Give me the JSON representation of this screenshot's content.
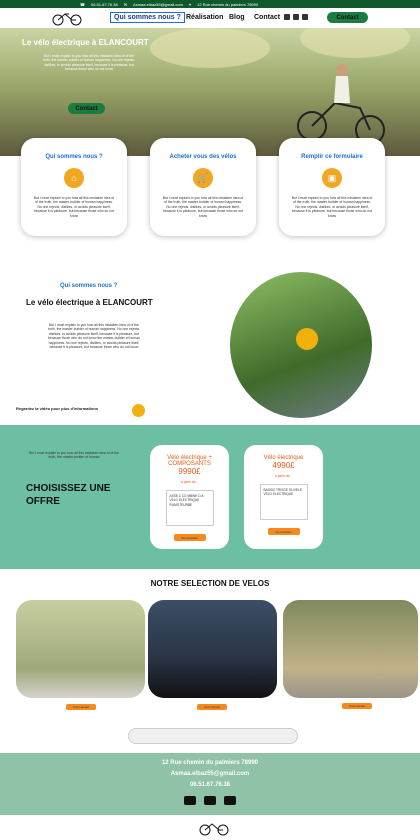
{
  "topbar": {
    "phone": "06.51.67.76.38",
    "email": "Asmaa.elbaz55@gmail.com",
    "address": "12 Rue chemin du palmiers 78990"
  },
  "nav": {
    "items": [
      "Qui sommes nous ?",
      "Réalisation",
      "Blog",
      "Contact"
    ],
    "cta": "Contact"
  },
  "hero": {
    "title": "Le vélo électrique  à ELANCOURT",
    "body": "But I must explain to you how all this mistaken idea of of the truth, the master-builder of human happiness. No one rejects, dislikes, or avoids pleasure itself, because it is pleasure, but because those who do not know",
    "button": "Contact"
  },
  "cards": [
    {
      "title": "Qui sommes nous ?",
      "icon": "home-icon",
      "body": "But I must explain to you how all this mistaken idea of of the truth, the master-builder of human happiness. No one rejects, dislikes, or avoids pleasure itself, because it is pleasure, but because those who do not know"
    },
    {
      "title": "Acheter vous des vélos",
      "icon": "cart-icon",
      "body": "But I must explain to you how all this mistaken idea of of the truth, the master-builder of human happiness. No one rejects, dislikes, or avoids pleasure itself, because it is pleasure, but because those who do not know"
    },
    {
      "title": "Remplir ce formulaire",
      "icon": "form-icon",
      "body": "But I must explain to you how all this mistaken idea of of the truth, the master-builder of human happiness. No one rejects, dislikes, or avoids pleasure itself, because it is pleasure, but because those who do not know"
    }
  ],
  "about": {
    "label": "Qui sommes nous ?",
    "title": "Le vélo électrique  à ELANCOURT",
    "body": "But I must explain to you how all this mistaken idea of of the truth, the master-builder of human happiness. No one rejects, dislikes, or avoids pleasure itself, because it is pleasure, but because those who do not know the master-builder of human happiness. No one rejects, dislikes, or avoids pleasure itself, because it is pleasure, but because those who do not know",
    "video": "Regardez la vidéo pour plus d'informations"
  },
  "offer": {
    "body": "But I must explain to you how all this mistaken idea of of the truth, the master-builder of human",
    "title": "CHOISISSEZ UNE OFFRE",
    "cards": [
      {
        "title": "Vélo électrique + COMPOSANTS",
        "price": "9990£",
        "small": "A partir de...",
        "desc": "ASSE Z CO MBINE D A VELO ELECTRIQUE RUMOTEURBE",
        "btn": "Commander"
      },
      {
        "title": "Vélo électrique",
        "price": "4990£",
        "small": "A partir de...",
        "desc": "BASSIC TRISGE OLIVELE VELO ELECTRIQUE",
        "btn": "Commander"
      }
    ]
  },
  "selection": {
    "title": "NOTRE SELECTION DE VELOS",
    "btn": "Commander"
  },
  "footer": {
    "address": "12 Rue chemin du palmiers 78990",
    "email": "Asmaa.elbaz55@gmail.com",
    "phone": "06.51.67.76.38"
  },
  "colors": {
    "green": "#1c7b3f",
    "teal": "#6dbfa4",
    "orange": "#f58a1f",
    "blue": "#1f6fd0"
  }
}
